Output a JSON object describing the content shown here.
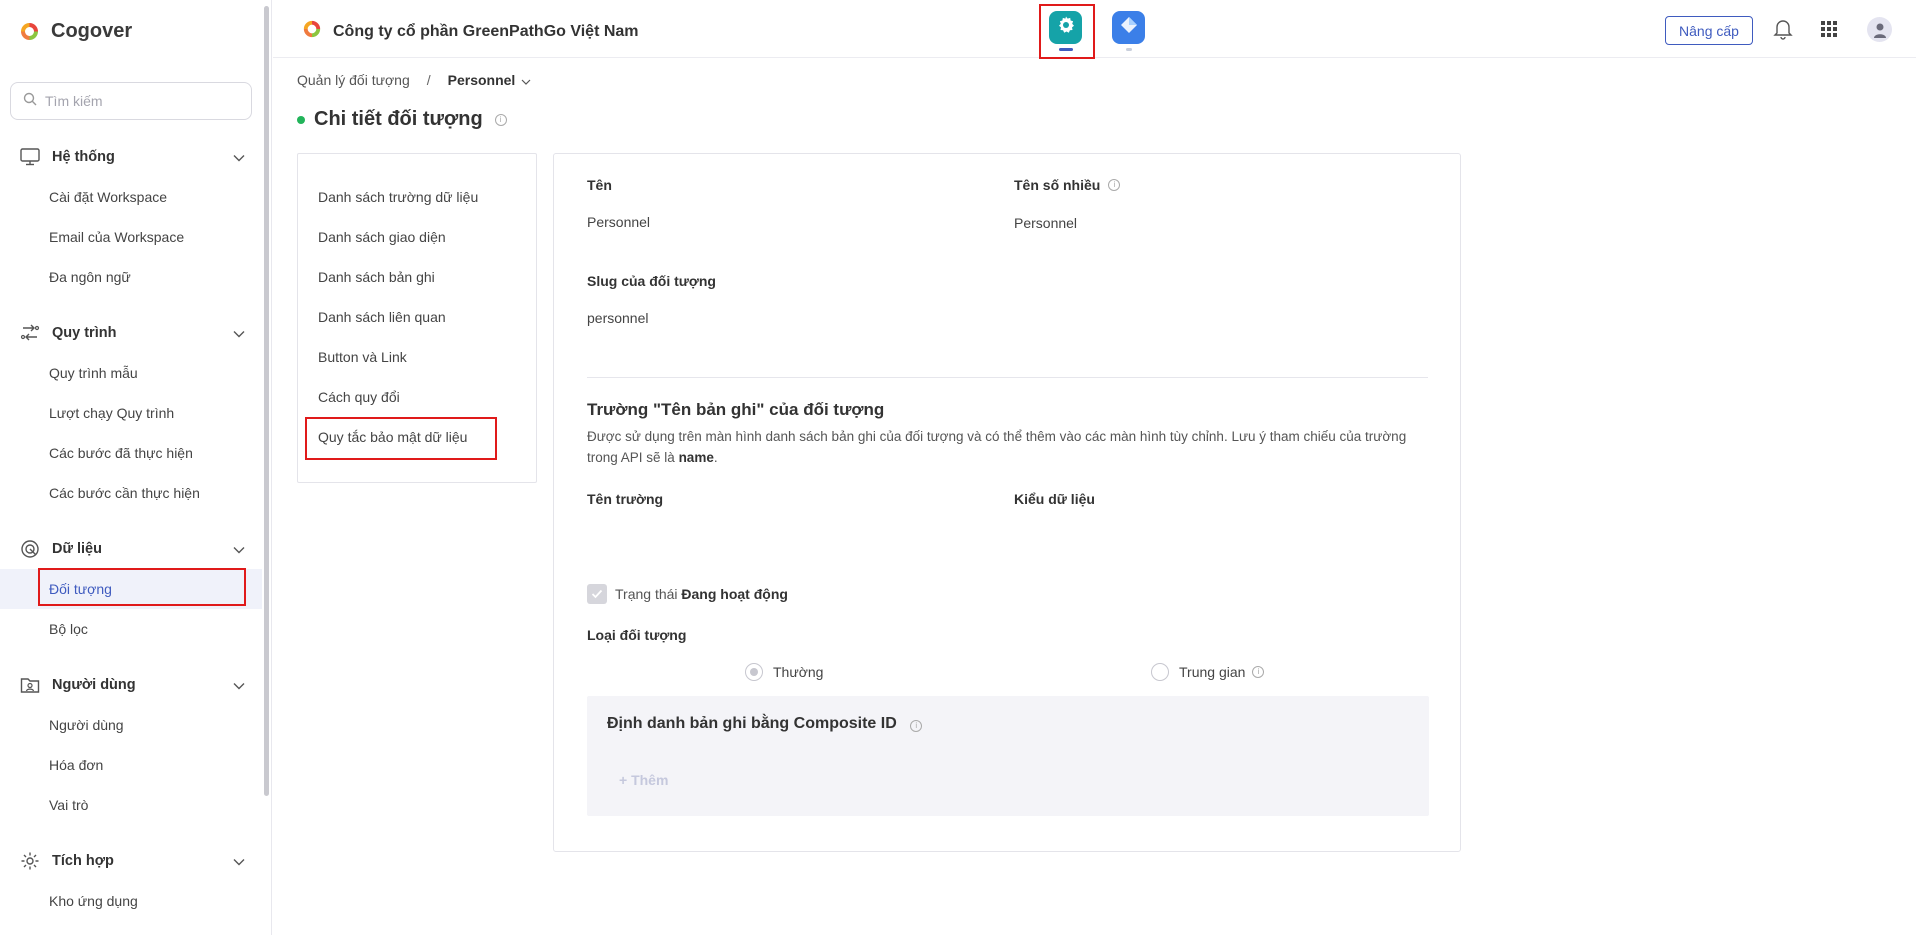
{
  "app": {
    "name": "Cogover"
  },
  "search": {
    "placeholder": "Tìm kiếm"
  },
  "sidebar": {
    "sections": [
      {
        "label": "Hệ thống",
        "icon": "monitor-icon",
        "items": [
          "Cài đặt Workspace",
          "Email của Workspace",
          "Đa ngôn ngữ"
        ]
      },
      {
        "label": "Quy trình",
        "icon": "workflow-icon",
        "items": [
          "Quy trình mẫu",
          "Lượt chạy Quy trình",
          "Các bước đã thực hiện",
          "Các bước cần thực hiện"
        ]
      },
      {
        "label": "Dữ liệu",
        "icon": "database-icon",
        "items": [
          "Đối tượng",
          "Bộ lọc"
        ]
      },
      {
        "label": "Người dùng",
        "icon": "user-folder-icon",
        "items": [
          "Người dùng",
          "Hóa đơn",
          "Vai trò"
        ]
      },
      {
        "label": "Tích hợp",
        "icon": "integration-icon",
        "items": [
          "Kho ứng dụng"
        ]
      }
    ],
    "active_item": "Đối tượng"
  },
  "header": {
    "company": "Công ty cổ phần GreenPathGo Việt Nam",
    "upgrade_label": "Nâng cấp"
  },
  "breadcrumb": {
    "parent": "Quản lý đối tượng",
    "separator": "/",
    "current": "Personnel"
  },
  "page": {
    "title": "Chi tiết đối tượng"
  },
  "detail_nav": {
    "items": [
      "Danh sách trường dữ liệu",
      "Danh sách giao diện",
      "Danh sách bản ghi",
      "Danh sách liên quan",
      "Button và Link",
      "Cách quy đổi",
      "Quy tắc bảo mật dữ liệu"
    ]
  },
  "detail": {
    "name_label": "Tên",
    "name_value": "Personnel",
    "plural_label": "Tên số nhiều",
    "plural_value": "Personnel",
    "slug_label": "Slug của đối tượng",
    "slug_value": "personnel",
    "record_field_title": "Trường \"Tên bản ghi\" của đối tượng",
    "record_field_desc": "Được sử dụng trên màn hình danh sách bản ghi của đối tượng và có thể thêm vào các màn hình tùy chỉnh. Lưu ý tham chiếu của trường trong API sẽ là ",
    "record_field_api": "name",
    "field_name_label": "Tên trường",
    "data_type_label": "Kiểu dữ liệu",
    "status_prefix": "Trạng thái ",
    "status_value": "Đang hoạt động",
    "status_checked": true,
    "object_type_label": "Loại đối tượng",
    "object_type_options": [
      "Thường",
      "Trung gian"
    ],
    "object_type_selected": "Thường",
    "composite_title": "Định danh bản ghi bằng Composite ID",
    "add_label": "+ Thêm"
  }
}
